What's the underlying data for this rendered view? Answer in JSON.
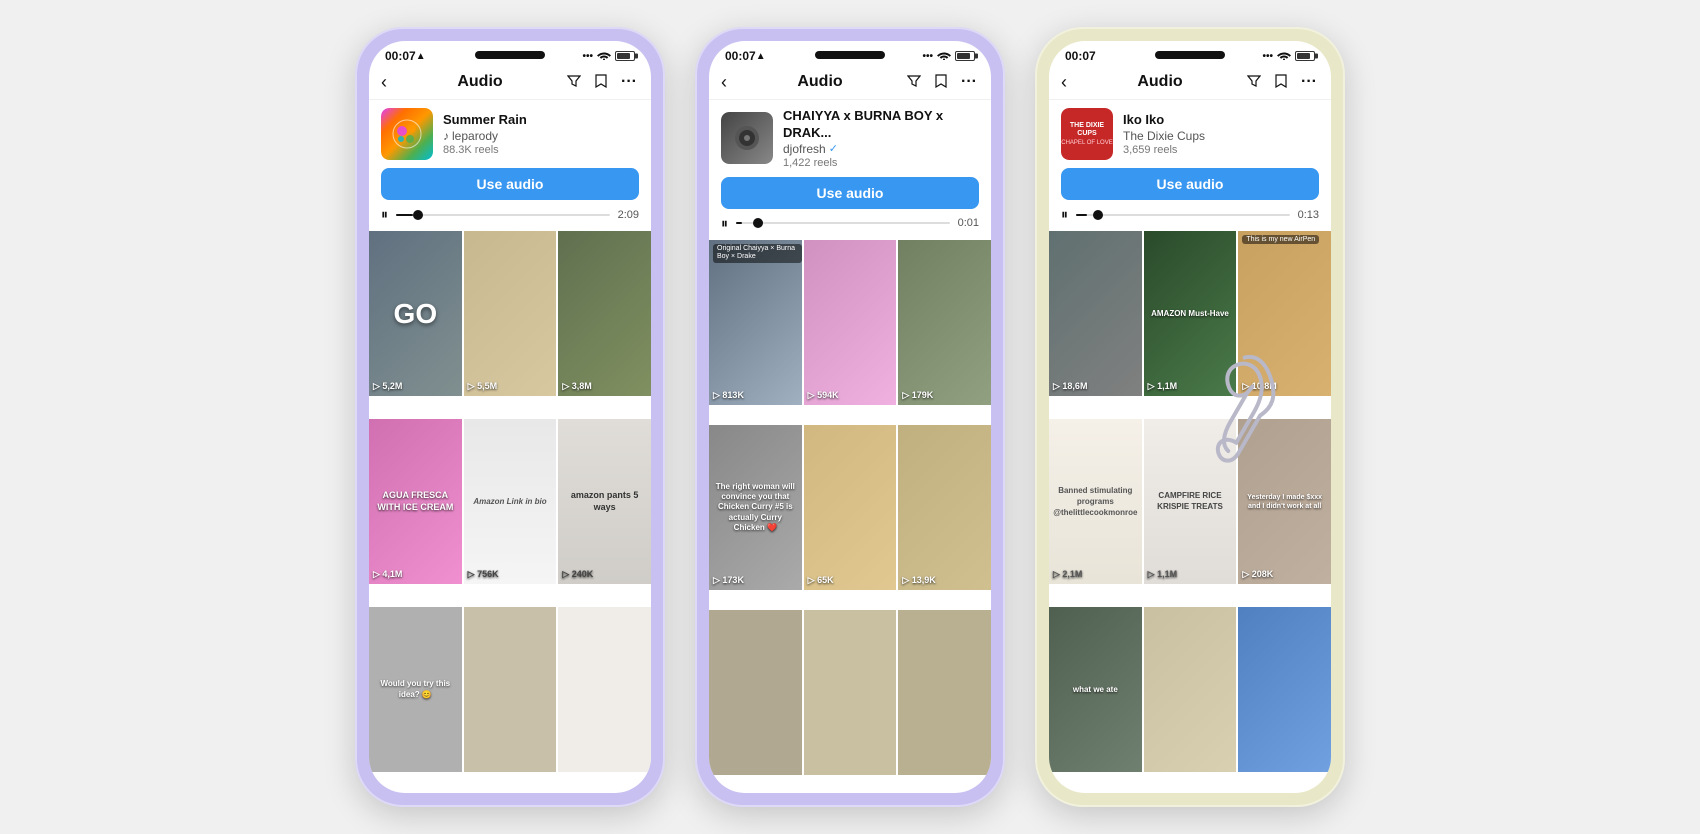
{
  "phones": [
    {
      "id": "phone-1",
      "color": "purple",
      "status": {
        "time": "00:07",
        "has_arrow": true,
        "signal": "...",
        "wifi": true,
        "battery": true
      },
      "nav": {
        "title": "Audio",
        "back": true
      },
      "audio": {
        "title": "Summer Rain",
        "artist": "leparody",
        "verified": false,
        "reel_count": "88.3K reels",
        "use_btn": "Use audio",
        "progress_time": "2:09",
        "thumb_type": "colorful"
      },
      "grid": [
        {
          "color": "p1c1",
          "count": "▷ 5,2M",
          "text": "GO",
          "text_class": "go-text"
        },
        {
          "color": "p1c2",
          "count": "▷ 5,5M",
          "text": ""
        },
        {
          "color": "p1c3",
          "count": "▷ 3,8M",
          "text": ""
        },
        {
          "color": "p1c4",
          "count": "▷ 4,1M",
          "text": "AGUA FRESCA with ICE CREAM",
          "text_class": "agua-text"
        },
        {
          "color": "p1c7",
          "count": "▷ 756K",
          "text": "Amazon Link in bio",
          "text_class": "amazon-text"
        },
        {
          "color": "p1c9",
          "count": "▷ 240K",
          "text": "amazon pants 5 ways",
          "text_class": "pants-text"
        },
        {
          "color": "p1c13",
          "count": "",
          "text": "Would you try this idea?"
        },
        {
          "color": "p1c14",
          "count": "",
          "text": ""
        },
        {
          "color": "p1c15",
          "count": "",
          "text": ""
        }
      ]
    },
    {
      "id": "phone-2",
      "color": "purple",
      "status": {
        "time": "00:07",
        "has_arrow": true,
        "signal": "...",
        "wifi": true,
        "battery": true
      },
      "nav": {
        "title": "Audio",
        "back": true
      },
      "audio": {
        "title": "CHAIYYA x BURNA BOY x DRAK...",
        "artist": "djofresh",
        "verified": true,
        "reel_count": "1,422 reels",
        "use_btn": "Use audio",
        "progress_time": "0:01",
        "thumb_type": "dj"
      },
      "grid": [
        {
          "color": "c1",
          "count": "▷ 813K",
          "tag": "Original Chaiyya x Burna Boy x Drake",
          "text": ""
        },
        {
          "color": "c5",
          "count": "▷ 594K",
          "text": ""
        },
        {
          "color": "c6",
          "count": "▷ 179K",
          "text": ""
        },
        {
          "color": "c2",
          "count": "▷ 173K",
          "text": "The right woman will convince you that Chicken Curry #5 is actually Curry Chicken"
        },
        {
          "color": "c7",
          "count": "▷ 65K",
          "text": ""
        },
        {
          "color": "c9",
          "count": "▷ 13,9K",
          "text": ""
        },
        {
          "color": "c10",
          "count": "",
          "text": ""
        },
        {
          "color": "c11",
          "count": "",
          "text": ""
        },
        {
          "color": "c12",
          "count": "",
          "text": ""
        }
      ]
    },
    {
      "id": "phone-3",
      "color": "yellow",
      "status": {
        "time": "00:07",
        "signal": "...",
        "wifi": true,
        "battery": true
      },
      "nav": {
        "title": "Audio",
        "back": true
      },
      "audio": {
        "title": "Iko Iko",
        "artist": "The Dixie Cups",
        "verified": false,
        "reel_count": "3,659 reels",
        "use_btn": "Use audio",
        "progress_time": "0:13",
        "thumb_type": "dixie"
      },
      "grid": [
        {
          "color": "c8",
          "count": "▷ 18,6M",
          "text": ""
        },
        {
          "color": "c3",
          "count": "▷ 1,1M",
          "text": "Amazon Must-Have",
          "text_class": "amazon-text"
        },
        {
          "color": "c4",
          "count": "▷ 10,8M",
          "text": "This is my new AirPen"
        },
        {
          "color": "c16",
          "count": "▷ 2,1M",
          "text": "Banned stimulating programs @thelittlecookmonroe",
          "text_class": "banned-text"
        },
        {
          "color": "c13",
          "count": "▷ 1,1M",
          "text": "CAMPFIRE RICE KRISPIE TREATS",
          "text_class": "campfire-text"
        },
        {
          "color": "c15",
          "count": "▷ 208K",
          "text": "Yesterday I made $xxx and I didn't work at all"
        },
        {
          "color": "c17",
          "count": "",
          "text": "what we ate"
        },
        {
          "color": "c18",
          "count": "",
          "text": ""
        },
        {
          "color": "c14",
          "count": "",
          "text": ""
        }
      ]
    }
  ],
  "paperclip_icon": "paperclip"
}
